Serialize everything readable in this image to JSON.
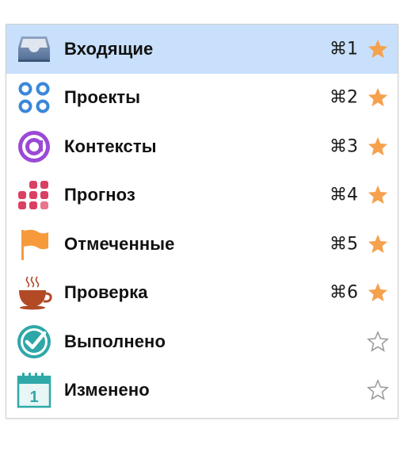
{
  "colors": {
    "selected_row": "#c8e0fb",
    "star_filled": "#f6a14d",
    "star_empty": "#9a9a9a",
    "projects_blue": "#3b87d9",
    "contexts_purple": "#9b49d6",
    "forecast_red": "#d94062",
    "flag_orange": "#f79a3c",
    "review_brown": "#b24a26",
    "completed_teal": "#2fa7a8",
    "changed_teal": "#2fa9a8"
  },
  "perspectives": [
    {
      "label": "Входящие",
      "shortcut": "⌘1",
      "icon": "inbox-tray-icon",
      "favorite": true,
      "selected": true
    },
    {
      "label": "Проекты",
      "shortcut": "⌘2",
      "icon": "projects-icon",
      "favorite": true,
      "selected": false
    },
    {
      "label": "Контексты",
      "shortcut": "⌘3",
      "icon": "at-sign-icon",
      "favorite": true,
      "selected": false
    },
    {
      "label": "Прогноз",
      "shortcut": "⌘4",
      "icon": "forecast-grid-icon",
      "favorite": true,
      "selected": false
    },
    {
      "label": "Отмеченные",
      "shortcut": "⌘5",
      "icon": "flag-icon",
      "favorite": true,
      "selected": false
    },
    {
      "label": "Проверка",
      "shortcut": "⌘6",
      "icon": "coffee-cup-icon",
      "favorite": true,
      "selected": false
    },
    {
      "label": "Выполнено",
      "shortcut": "",
      "icon": "checkmark-circle-icon",
      "favorite": false,
      "selected": false
    },
    {
      "label": "Изменено",
      "shortcut": "",
      "icon": "calendar-icon",
      "favorite": false,
      "selected": false
    }
  ]
}
